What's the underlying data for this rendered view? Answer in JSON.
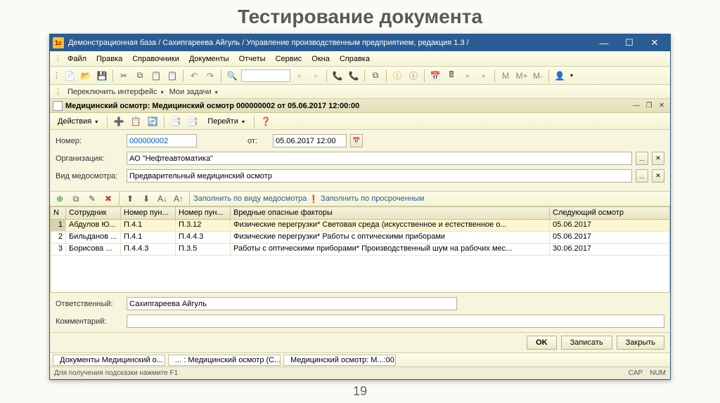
{
  "page": {
    "title": "Тестирование документа",
    "number": "19"
  },
  "window": {
    "title": "Демонстрационная база / Сахипгареева Айгуль /  Управление производственным предприятием, редакция 1.3 /"
  },
  "menu": [
    "Файл",
    "Правка",
    "Справочники",
    "Документы",
    "Отчеты",
    "Сервис",
    "Окна",
    "Справка"
  ],
  "tabstrip": {
    "switch": "Переключить интерфейс",
    "tasks": "Мои задачи"
  },
  "doc": {
    "header": "Медицинский осмотр: Медицинский осмотр 000000002 от 05.06.2017 12:00:00",
    "actions": "Действия",
    "goto": "Перейти",
    "labels": {
      "number": "Номер:",
      "from": "от:",
      "org": "Организация:",
      "type": "Вид медосмотра:",
      "resp": "Ответственный:",
      "comment": "Комментарий:"
    },
    "fields": {
      "number": "000000002",
      "date": "05.06.2017 12:00",
      "org": "АО \"Нефтеавтоматика\"",
      "type": "Предварительный медицинский осмотр",
      "resp": "Сахипгареева Айгуль",
      "comment": ""
    }
  },
  "gridtoolbar": {
    "fillByType": "Заполнить по виду медосмотра",
    "fillOverdue": "Заполнить по просроченным"
  },
  "grid": {
    "headers": [
      "N",
      "Сотрудник",
      "Номер пун...",
      "Номер пун...",
      "Вредные опасные факторы",
      "Следующий осмотр"
    ],
    "rows": [
      {
        "n": "1",
        "emp": "Абдулов Ю...",
        "p1": "П.4.1",
        "p2": "П.3.12",
        "fact": "Физические перегрузки* Световая среда (искусственное и естественное о...",
        "next": "05.06.2017"
      },
      {
        "n": "2",
        "emp": "Бильданов ...",
        "p1": "П.4.1",
        "p2": "П.4.4.3",
        "fact": "Физические перегрузки* Работы с оптическими приборами",
        "next": "05.06.2017"
      },
      {
        "n": "3",
        "emp": "Борисова ...",
        "p1": "П.4.4.3",
        "p2": "П.3.5",
        "fact": "Работы с оптическими приборами* Производственный шум на рабочих мес...",
        "next": "30.06.2017"
      }
    ]
  },
  "buttons": {
    "ok": "OK",
    "save": "Записать",
    "close": "Закрыть"
  },
  "bottomTabs": [
    "Документы Медицинский о...",
    "... : Медицинский осмотр (С...",
    "Медицинский осмотр: М...:00"
  ],
  "status": {
    "hint": "Для получения подсказки нажмите F1",
    "cap": "CAP",
    "num": "NUM"
  }
}
